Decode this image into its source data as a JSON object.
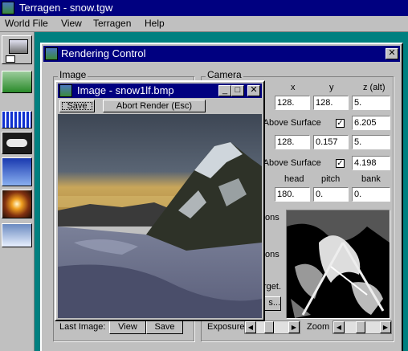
{
  "app": {
    "title": "Terragen  -  snow.tgw"
  },
  "menu": [
    "World File",
    "View",
    "Terragen",
    "Help"
  ],
  "toolbar": [
    "landscape",
    "terrain",
    "water",
    "clouds",
    "sky",
    "sun",
    "render"
  ],
  "rendering_control": {
    "title": "Rendering Control",
    "image_group": "Image",
    "last_image_label": "Last Image:",
    "view_label": "View",
    "save_label": "Save",
    "camera_group": "Camera",
    "col_x": "x",
    "col_y": "y",
    "col_z": "z (alt)",
    "camera_pos": [
      "128.",
      "128.",
      "5."
    ],
    "height_label_1": "ht Above Surface",
    "height_val_1": "6.205",
    "target_pos": [
      "128.",
      "0.157",
      "5."
    ],
    "height_label_2": "ht Above Surface",
    "height_val_2": "4.198",
    "col_head": "head",
    "col_pitch": "pitch",
    "col_bank": "bank",
    "orientation": [
      "180.",
      "0.",
      "0."
    ],
    "frag_ons_1": "ons",
    "frag_ons_2": "ons",
    "frag_get": "rget.",
    "frag_s": "s...",
    "exposure_label": "Exposure",
    "zoom_label": "Zoom"
  },
  "image_window": {
    "title": "Image - snow1lf.bmp",
    "save_label": "Save",
    "abort_label": "Abort Render (Esc)"
  },
  "colors": {
    "titlebar": "#000080",
    "desktop": "#008080",
    "face": "#c0c0c0"
  }
}
